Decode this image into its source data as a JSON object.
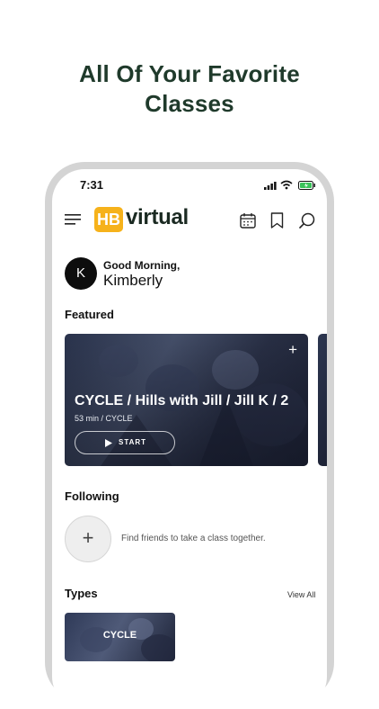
{
  "headline": {
    "line1": "All Of Your Favorite",
    "line2": "Classes"
  },
  "status_bar": {
    "time": "7:31"
  },
  "app": {
    "logo_badge": "HB",
    "logo_word": "virtual"
  },
  "greeting": {
    "avatar_initial": "K",
    "hello": "Good Morning,",
    "name": "Kimberly"
  },
  "featured": {
    "title": "Featured",
    "card": {
      "title": "CYCLE / Hills with Jill / Jill K / 2",
      "meta": "53 min  /  CYCLE",
      "start_label": "START",
      "add_symbol": "+"
    }
  },
  "following": {
    "title": "Following",
    "add_symbol": "+",
    "empty_text": "Find friends to take a class together."
  },
  "types": {
    "title": "Types",
    "view_all": "View All",
    "items": [
      {
        "label": "CYCLE"
      }
    ]
  },
  "colors": {
    "accent": "#f6b21b",
    "headline": "#1f3a2b",
    "frame": "#d4d4d4"
  },
  "icons": [
    "menu-icon",
    "calendar-icon",
    "bookmark-icon",
    "search-icon",
    "play-icon",
    "signal-icon",
    "wifi-icon",
    "battery-icon"
  ]
}
